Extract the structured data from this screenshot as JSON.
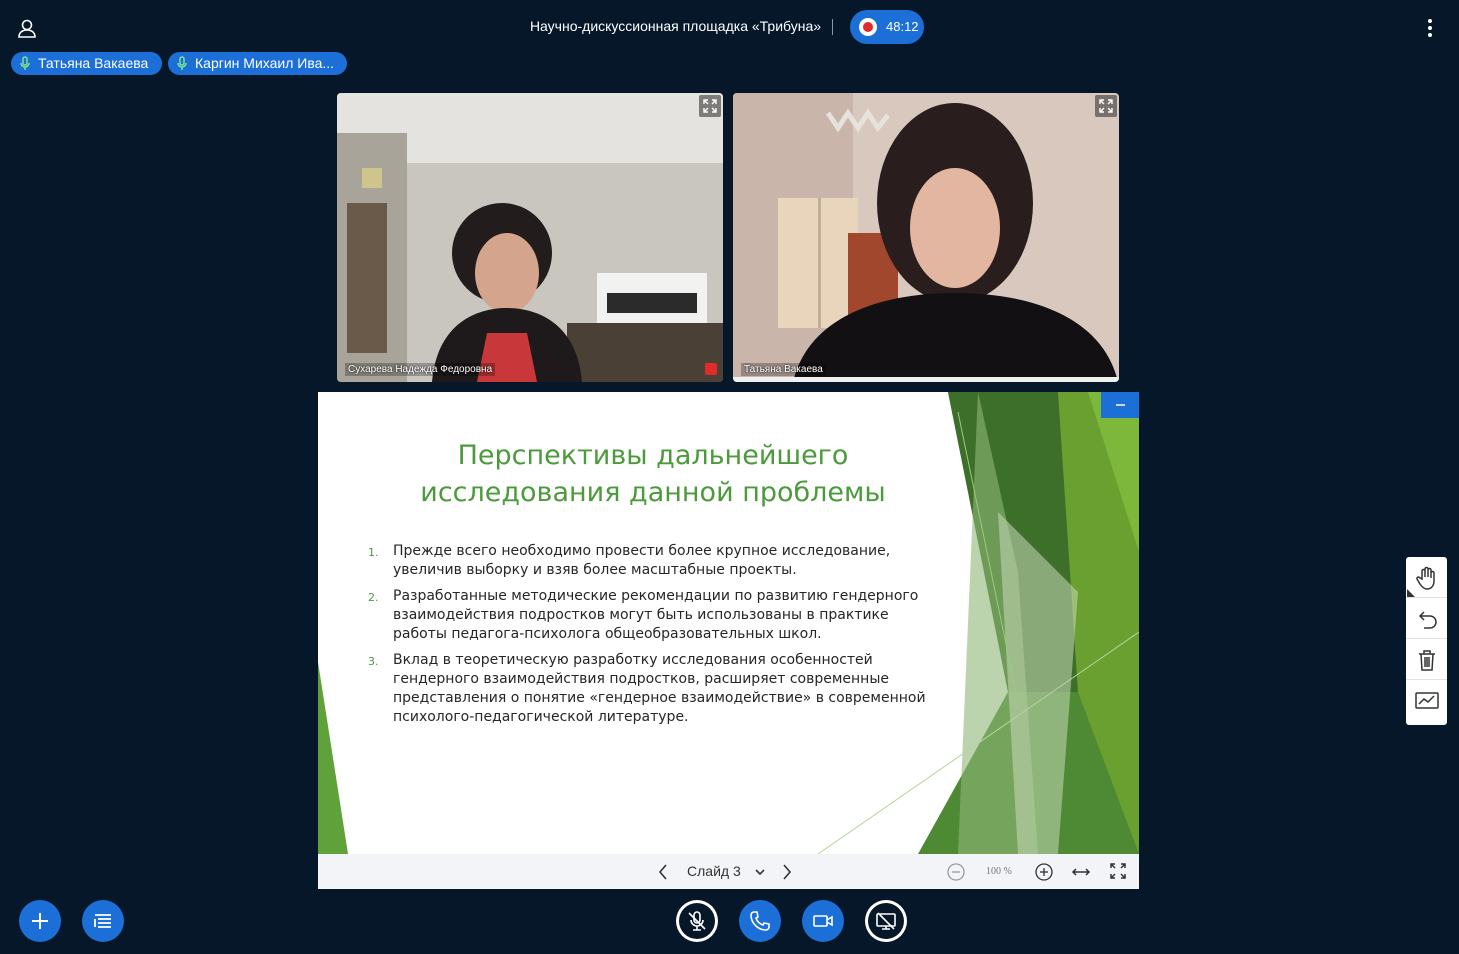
{
  "meeting": {
    "title": "Научно-дискуссионная площадка «Трибуна»",
    "recording_time": "48:12"
  },
  "talkers": [
    {
      "name": "Татьяна Вакаева"
    },
    {
      "name": "Каргин Михаил Ива..."
    }
  ],
  "videos": [
    {
      "name": "Сухарева Надежда Федоровна"
    },
    {
      "name": "Татьяна Вакаева"
    }
  ],
  "slide": {
    "title_line1": "Перспективы дальнейшего",
    "title_line2": "исследования данной проблемы",
    "items": [
      {
        "num": "1.",
        "text": "Прежде всего необходимо провести более крупное исследование, увеличив выборку и взяв более масштабные проекты."
      },
      {
        "num": "2.",
        "text": "Разработанные методические рекомендации по развитию гендерного взаимодействия подростков могут быть использованы в практике работы педагога-психолога общеобразовательных школ."
      },
      {
        "num": "3.",
        "text": "Вклад в теоретическую разработку исследования особенностей гендерного взаимодействия подростков, расширяет современные представления о понятие «гендерное взаимодействие» в современной психолого-педагогической литературе."
      }
    ]
  },
  "presentation_toolbar": {
    "slide_label": "Слайд 3",
    "zoom": "100 %"
  },
  "colors": {
    "accent": "#1b6fd6",
    "background": "#06172a",
    "slide_green": "#4b9a3b",
    "record": "#e12a2a"
  },
  "icons": {
    "user": "user-icon",
    "options": "more-vertical-icon",
    "mic": "microphone-icon",
    "whiteboard": [
      "hand-icon",
      "undo-icon",
      "trash-icon",
      "multi-user-board-icon"
    ],
    "bottom": [
      "plus-icon",
      "list-icon",
      "mic-muted-icon",
      "phone-icon",
      "camera-icon",
      "screenshare-off-icon"
    ]
  }
}
